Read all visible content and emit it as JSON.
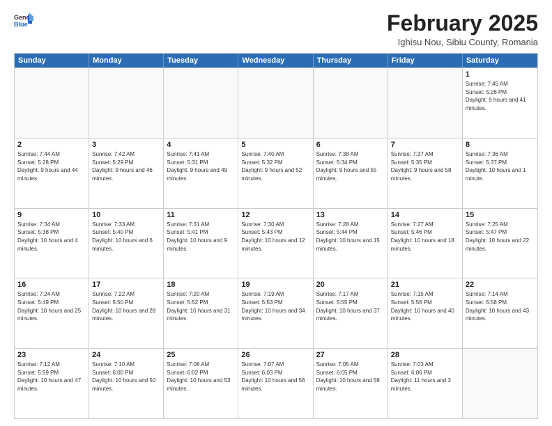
{
  "logo": {
    "general": "General",
    "blue": "Blue"
  },
  "header": {
    "title": "February 2025",
    "subtitle": "Ighisu Nou, Sibiu County, Romania"
  },
  "weekdays": [
    "Sunday",
    "Monday",
    "Tuesday",
    "Wednesday",
    "Thursday",
    "Friday",
    "Saturday"
  ],
  "rows": [
    [
      {
        "day": "",
        "info": ""
      },
      {
        "day": "",
        "info": ""
      },
      {
        "day": "",
        "info": ""
      },
      {
        "day": "",
        "info": ""
      },
      {
        "day": "",
        "info": ""
      },
      {
        "day": "",
        "info": ""
      },
      {
        "day": "1",
        "info": "Sunrise: 7:45 AM\nSunset: 5:26 PM\nDaylight: 9 hours and 41 minutes."
      }
    ],
    [
      {
        "day": "2",
        "info": "Sunrise: 7:44 AM\nSunset: 5:28 PM\nDaylight: 9 hours and 44 minutes."
      },
      {
        "day": "3",
        "info": "Sunrise: 7:42 AM\nSunset: 5:29 PM\nDaylight: 9 hours and 46 minutes."
      },
      {
        "day": "4",
        "info": "Sunrise: 7:41 AM\nSunset: 5:31 PM\nDaylight: 9 hours and 49 minutes."
      },
      {
        "day": "5",
        "info": "Sunrise: 7:40 AM\nSunset: 5:32 PM\nDaylight: 9 hours and 52 minutes."
      },
      {
        "day": "6",
        "info": "Sunrise: 7:38 AM\nSunset: 5:34 PM\nDaylight: 9 hours and 55 minutes."
      },
      {
        "day": "7",
        "info": "Sunrise: 7:37 AM\nSunset: 5:35 PM\nDaylight: 9 hours and 58 minutes."
      },
      {
        "day": "8",
        "info": "Sunrise: 7:36 AM\nSunset: 5:37 PM\nDaylight: 10 hours and 1 minute."
      }
    ],
    [
      {
        "day": "9",
        "info": "Sunrise: 7:34 AM\nSunset: 5:38 PM\nDaylight: 10 hours and 4 minutes."
      },
      {
        "day": "10",
        "info": "Sunrise: 7:33 AM\nSunset: 5:40 PM\nDaylight: 10 hours and 6 minutes."
      },
      {
        "day": "11",
        "info": "Sunrise: 7:31 AM\nSunset: 5:41 PM\nDaylight: 10 hours and 9 minutes."
      },
      {
        "day": "12",
        "info": "Sunrise: 7:30 AM\nSunset: 5:43 PM\nDaylight: 10 hours and 12 minutes."
      },
      {
        "day": "13",
        "info": "Sunrise: 7:28 AM\nSunset: 5:44 PM\nDaylight: 10 hours and 15 minutes."
      },
      {
        "day": "14",
        "info": "Sunrise: 7:27 AM\nSunset: 5:46 PM\nDaylight: 10 hours and 18 minutes."
      },
      {
        "day": "15",
        "info": "Sunrise: 7:25 AM\nSunset: 5:47 PM\nDaylight: 10 hours and 22 minutes."
      }
    ],
    [
      {
        "day": "16",
        "info": "Sunrise: 7:24 AM\nSunset: 5:49 PM\nDaylight: 10 hours and 25 minutes."
      },
      {
        "day": "17",
        "info": "Sunrise: 7:22 AM\nSunset: 5:50 PM\nDaylight: 10 hours and 28 minutes."
      },
      {
        "day": "18",
        "info": "Sunrise: 7:20 AM\nSunset: 5:52 PM\nDaylight: 10 hours and 31 minutes."
      },
      {
        "day": "19",
        "info": "Sunrise: 7:19 AM\nSunset: 5:53 PM\nDaylight: 10 hours and 34 minutes."
      },
      {
        "day": "20",
        "info": "Sunrise: 7:17 AM\nSunset: 5:55 PM\nDaylight: 10 hours and 37 minutes."
      },
      {
        "day": "21",
        "info": "Sunrise: 7:15 AM\nSunset: 5:56 PM\nDaylight: 10 hours and 40 minutes."
      },
      {
        "day": "22",
        "info": "Sunrise: 7:14 AM\nSunset: 5:58 PM\nDaylight: 10 hours and 43 minutes."
      }
    ],
    [
      {
        "day": "23",
        "info": "Sunrise: 7:12 AM\nSunset: 5:59 PM\nDaylight: 10 hours and 47 minutes."
      },
      {
        "day": "24",
        "info": "Sunrise: 7:10 AM\nSunset: 6:00 PM\nDaylight: 10 hours and 50 minutes."
      },
      {
        "day": "25",
        "info": "Sunrise: 7:08 AM\nSunset: 6:02 PM\nDaylight: 10 hours and 53 minutes."
      },
      {
        "day": "26",
        "info": "Sunrise: 7:07 AM\nSunset: 6:03 PM\nDaylight: 10 hours and 56 minutes."
      },
      {
        "day": "27",
        "info": "Sunrise: 7:05 AM\nSunset: 6:05 PM\nDaylight: 10 hours and 59 minutes."
      },
      {
        "day": "28",
        "info": "Sunrise: 7:03 AM\nSunset: 6:06 PM\nDaylight: 11 hours and 3 minutes."
      },
      {
        "day": "",
        "info": ""
      }
    ]
  ]
}
